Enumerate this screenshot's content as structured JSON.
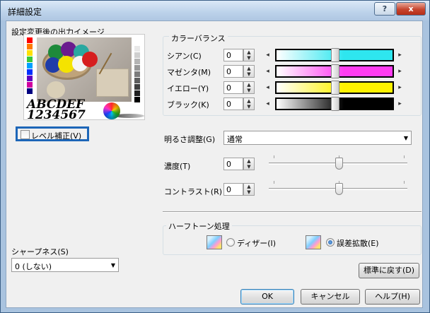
{
  "window": {
    "title": "詳細設定",
    "help_glyph": "?",
    "close_glyph": "x"
  },
  "preview": {
    "label": "設定変更後の出力イメージ",
    "sample_line1": "ABCDEF",
    "sample_line2": "1234567"
  },
  "level_correction": {
    "label": "レベル補正(V)",
    "checked": false
  },
  "color_balance": {
    "title": "カラーバランス",
    "left_arrow": "◂",
    "right_arrow": "▸",
    "rows": [
      {
        "label": "シアン(C)",
        "value": "0",
        "color": "#2ee6ef"
      },
      {
        "label": "マゼンタ(M)",
        "value": "0",
        "color": "#ff3cf0"
      },
      {
        "label": "イエロー(Y)",
        "value": "0",
        "color": "#fff200"
      },
      {
        "label": "ブラック(K)",
        "value": "0",
        "color": "#000000"
      }
    ]
  },
  "brightness": {
    "label": "明るさ調整(G)",
    "value": "通常"
  },
  "density": {
    "label": "濃度(T)",
    "value": "0"
  },
  "contrast": {
    "label": "コントラスト(R)",
    "value": "0"
  },
  "halftone": {
    "title": "ハーフトーン処理",
    "dither_label": "ディザー(I)",
    "diffusion_label": "誤差拡散(E)",
    "selected": "diffusion"
  },
  "sharpness": {
    "label": "シャープネス(S)",
    "value": "0 (しない)"
  },
  "buttons": {
    "reset": "標準に戻す(D)",
    "ok": "OK",
    "cancel": "キャンセル",
    "help": "ヘルプ(H)"
  },
  "spin_arrows": {
    "up": "▲",
    "down": "▼"
  },
  "dropdown_arrow": "▼"
}
